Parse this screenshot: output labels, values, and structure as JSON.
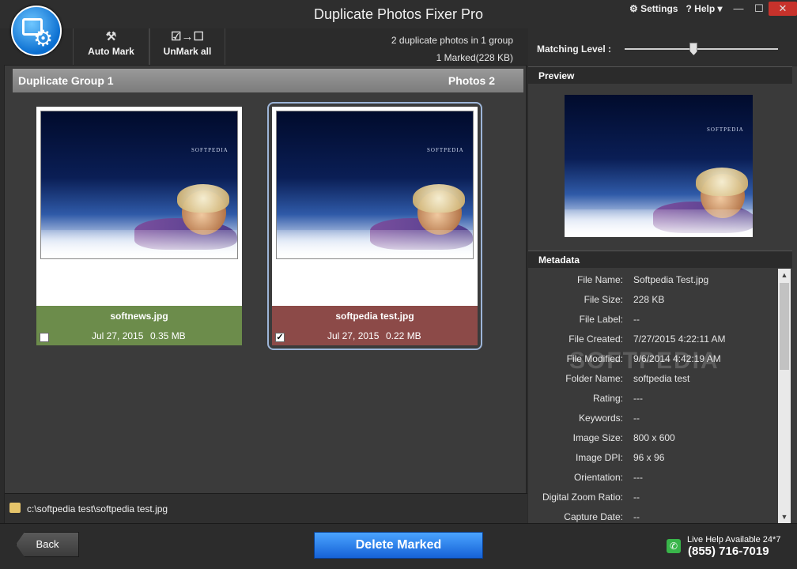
{
  "window": {
    "title": "Duplicate Photos Fixer Pro",
    "settings_label": "Settings",
    "help_label": "Help",
    "minimize": "—",
    "maximize": "☐",
    "close": "✕"
  },
  "toolbar": {
    "auto_mark_label": "Auto Mark",
    "unmark_all_label": "UnMark all",
    "summary": "2 duplicate photos in 1 group",
    "marked": "1 Marked(228 KB)"
  },
  "group": {
    "title": "Duplicate Group 1",
    "count": "Photos 2",
    "photos": [
      {
        "name": "softnews.jpg",
        "date": "Jul 27, 2015",
        "size": "0.35 MB",
        "checked": false
      },
      {
        "name": "softpedia test.jpg",
        "date": "Jul 27, 2015",
        "size": "0.22 MB",
        "checked": true
      }
    ]
  },
  "path": "c:\\softpedia test\\softpedia test.jpg",
  "matching": {
    "label": "Matching Level :",
    "level": 0.45
  },
  "preview": {
    "title": "Preview",
    "watermark": "SOFTPEDIA"
  },
  "metadata": {
    "title": "Metadata",
    "rows": [
      {
        "key": "File Name:",
        "value": "Softpedia Test.jpg"
      },
      {
        "key": "File Size:",
        "value": "228 KB"
      },
      {
        "key": "File Label:",
        "value": "--"
      },
      {
        "key": "File Created:",
        "value": "7/27/2015 4:22:11 AM"
      },
      {
        "key": "File Modified:",
        "value": "9/6/2014 4:42:19 AM"
      },
      {
        "key": "Folder Name:",
        "value": "softpedia test"
      },
      {
        "key": "Rating:",
        "value": "---"
      },
      {
        "key": "Keywords:",
        "value": "--"
      },
      {
        "key": "Image Size:",
        "value": "800 x 600"
      },
      {
        "key": "Image DPI:",
        "value": "96 x 96"
      },
      {
        "key": "Orientation:",
        "value": "---"
      },
      {
        "key": "Digital Zoom Ratio:",
        "value": "--"
      },
      {
        "key": "Capture Date:",
        "value": "--"
      }
    ]
  },
  "bottom": {
    "back_label": "Back",
    "delete_label": "Delete Marked",
    "help_text": "Live Help Available 24*7",
    "phone": "(855) 716-7019"
  },
  "colors": {
    "unmarked_card": "#6c8c4b",
    "marked_card": "#8c4a48",
    "delete_button": "#1662d6"
  }
}
